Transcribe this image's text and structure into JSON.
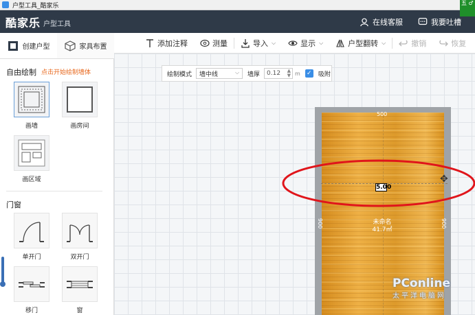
{
  "window": {
    "title": "户型工具_酷家乐",
    "tray_text": "五 ♂"
  },
  "header": {
    "logo": "酷家乐",
    "logo_sub": "户型工具",
    "online_service": "在线客服",
    "feedback": "我要吐槽"
  },
  "left_tabs": [
    {
      "label": "创建户型",
      "icon": "floorplan-icon",
      "active": true
    },
    {
      "label": "家具布置",
      "icon": "cube-icon",
      "active": false
    }
  ],
  "sidebar": {
    "draw_title": "自由绘制",
    "draw_hint": "点击开始绘制墙体",
    "draw_tools": [
      {
        "label": "画墙"
      },
      {
        "label": "画房间"
      },
      {
        "label": "画区域"
      }
    ],
    "doors_title": "门窗",
    "door_tools": [
      {
        "label": "单开门"
      },
      {
        "label": "双开门"
      },
      {
        "label": "移门"
      },
      {
        "label": "窗"
      }
    ]
  },
  "toolbar": {
    "items": [
      {
        "label": "添加注释",
        "icon": "text-icon",
        "dropdown": false,
        "disabled": false
      },
      {
        "label": "测量",
        "icon": "tape-measure-icon",
        "dropdown": false,
        "disabled": false
      },
      {
        "label": "导入",
        "icon": "import-icon",
        "dropdown": true,
        "disabled": false
      },
      {
        "label": "显示",
        "icon": "eye-icon",
        "dropdown": true,
        "disabled": false
      },
      {
        "label": "户型翻转",
        "icon": "flip-icon",
        "dropdown": true,
        "disabled": false
      },
      {
        "label": "撤销",
        "icon": "undo-icon",
        "dropdown": false,
        "disabled": true
      },
      {
        "label": "恢复",
        "icon": "redo-icon",
        "dropdown": false,
        "disabled": true
      }
    ]
  },
  "draw_mode_panel": {
    "mode_label": "绘制模式",
    "mode_value": "墙中线",
    "thickness_label": "墙厚",
    "thickness_value": "0.12",
    "thickness_unit": "m",
    "snap_label": "吸附",
    "snap_checked": true
  },
  "room": {
    "dim_top": "500",
    "dim_left": "900",
    "dim_right": "900",
    "dim_edit": "5.00",
    "name": "未命名",
    "area": "41.7㎡"
  },
  "watermark": {
    "brand": "PConline",
    "sub": "太平洋电脑网"
  },
  "colors": {
    "header_bg": "#2f3a48",
    "accent": "#3a8ee6",
    "hint": "#e8691f",
    "annotation": "#e0151b"
  }
}
